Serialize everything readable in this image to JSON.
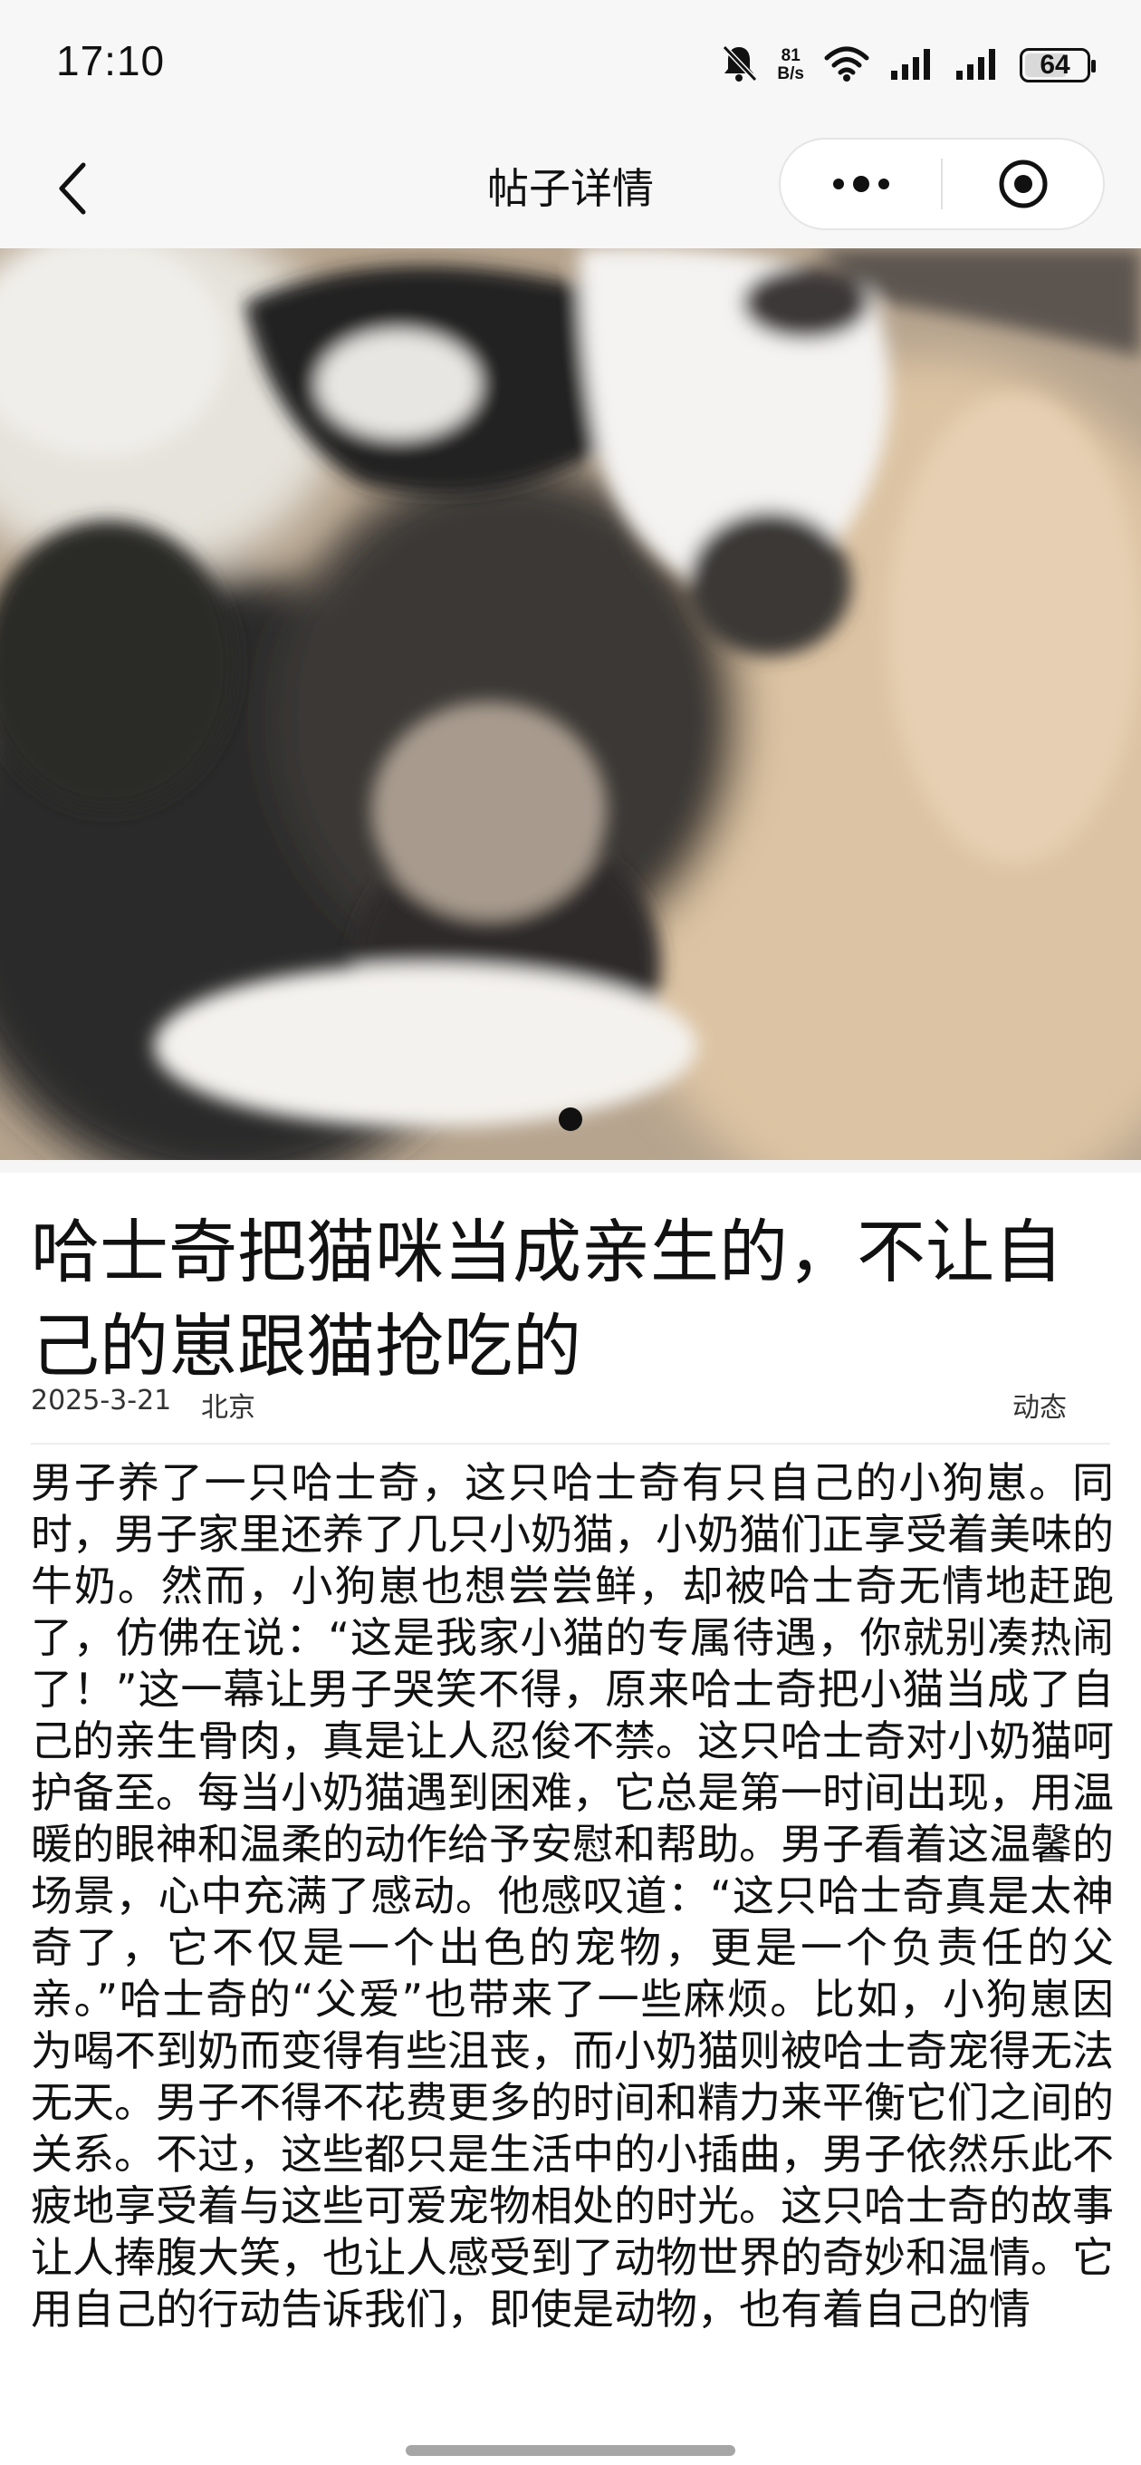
{
  "status_bar": {
    "time": "17:10",
    "net_speed_value": "81",
    "net_speed_unit": "B/s",
    "battery_level": "64",
    "icons": [
      "bell-muted-icon",
      "wifi-icon",
      "signal-icon",
      "signal-icon",
      "battery-icon"
    ]
  },
  "nav": {
    "title": "帖子详情",
    "icons": [
      "chevron-left-icon",
      "more-icon",
      "record-icon"
    ]
  },
  "carousel": {
    "current_index": 1,
    "total": 1
  },
  "post": {
    "title": "哈士奇把猫咪当成亲生的，不让自己的崽跟猫抢吃的",
    "date": "2025-3-21",
    "location": "北京",
    "tag": "动态",
    "body": "男子养了一只哈士奇，这只哈士奇有只自己的小狗崽。同时，男子家里还养了几只小奶猫，小奶猫们正享受着美味的牛奶。然而，小狗崽也想尝尝鲜，却被哈士奇无情地赶跑了，仿佛在说：“这是我家小猫的专属待遇，你就别凑热闹了！”这一幕让男子哭笑不得，原来哈士奇把小猫当成了自己的亲生骨肉，真是让人忍俊不禁。这只哈士奇对小奶猫呵护备至。每当小奶猫遇到困难，它总是第一时间出现，用温暖的眼神和温柔的动作给予安慰和帮助。男子看着这温馨的场景，心中充满了感动。他感叹道：“这只哈士奇真是太神奇了，它不仅是一个出色的宠物，更是一个负责任的父亲。”哈士奇的“父爱”也带来了一些麻烦。比如，小狗崽因为喝不到奶而变得有些沮丧，而小奶猫则被哈士奇宠得无法无天。男子不得不花费更多的时间和精力来平衡它们之间的关系。不过，这些都只是生活中的小插曲，男子依然乐此不疲地享受着与这些可爱宠物相处的时光。这只哈士奇的故事让人捧腹大笑，也让人感受到了动物世界的奇妙和温情。它用自己的行动告诉我们，即使是动物，也有着自己的情"
  }
}
